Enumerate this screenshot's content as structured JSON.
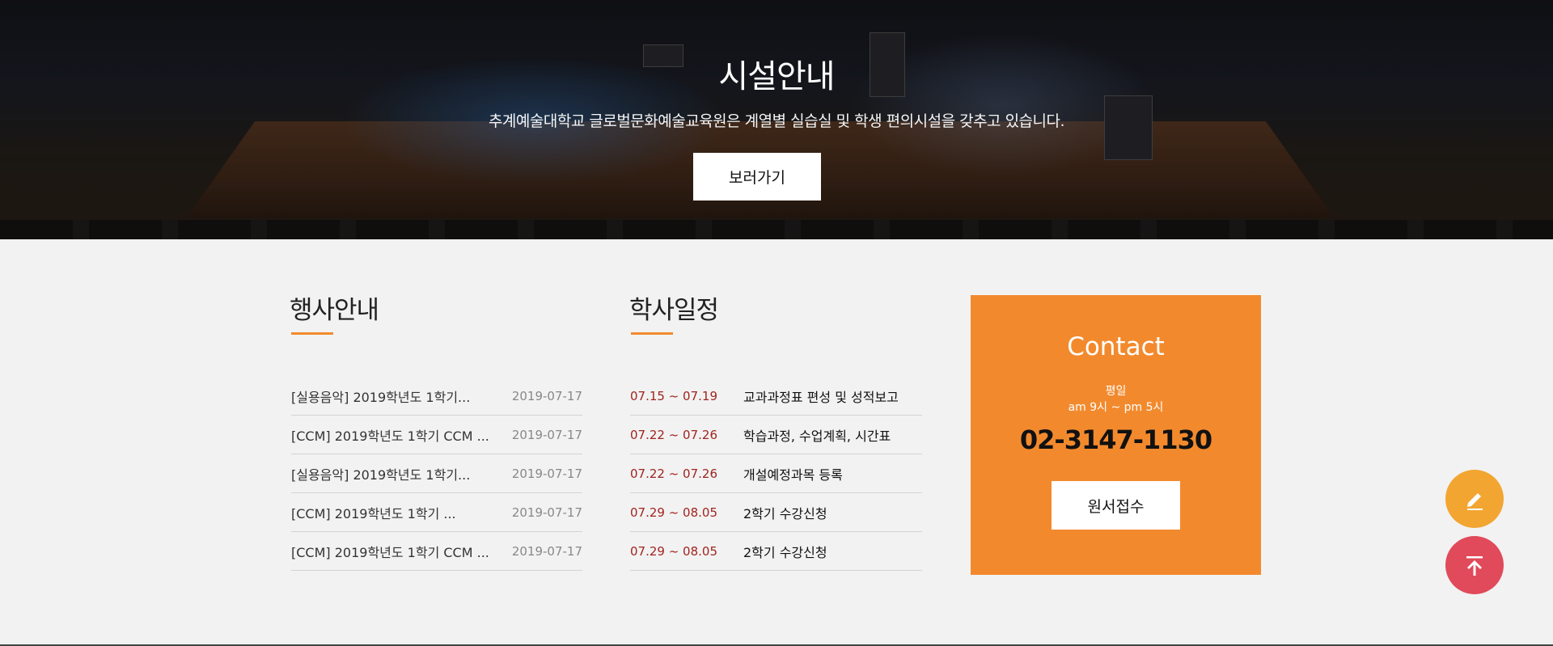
{
  "hero": {
    "title": "시설안내",
    "subtitle": "추계예술대학교 글로벌문화예술교육원은 계열별 실습실 및 학생 편의시설을 갖추고 있습니다.",
    "button_label": "보러가기"
  },
  "events": {
    "title": "행사안내",
    "items": [
      {
        "title": "[실용음악] 2019학년도 1학기...",
        "date": "2019-07-17"
      },
      {
        "title": "[CCM] 2019학년도 1학기 CCM ...",
        "date": "2019-07-17"
      },
      {
        "title": "[실용음악] 2019학년도 1학기...",
        "date": "2019-07-17"
      },
      {
        "title": "[CCM] 2019학년도 1학기 ...",
        "date": "2019-07-17"
      },
      {
        "title": "[CCM] 2019학년도 1학기 CCM ...",
        "date": "2019-07-17"
      }
    ]
  },
  "schedule": {
    "title": "학사일정",
    "items": [
      {
        "date": "07.15 ~ 07.19",
        "text": "교과과정표 편성 및 성적보고"
      },
      {
        "date": "07.22 ~ 07.26",
        "text": "학습과정, 수업계획, 시간표"
      },
      {
        "date": "07.22 ~ 07.26",
        "text": "개설예정과목 등록"
      },
      {
        "date": "07.29 ~ 08.05",
        "text": "2학기 수강신청"
      },
      {
        "date": "07.29 ~ 08.05",
        "text": "2학기 수강신청"
      }
    ]
  },
  "contact": {
    "title": "Contact",
    "day": "평일",
    "hours": "am 9시 ~ pm 5시",
    "phone": "02-3147-1130",
    "button_label": "원서접수"
  },
  "floating": {
    "write_icon": "pencil-icon",
    "top_icon": "arrow-up-icon"
  },
  "colors": {
    "accent_orange": "#f28a2d",
    "date_red": "#a0241f",
    "fab_write": "#f2a531",
    "fab_top": "#e04a5a"
  }
}
